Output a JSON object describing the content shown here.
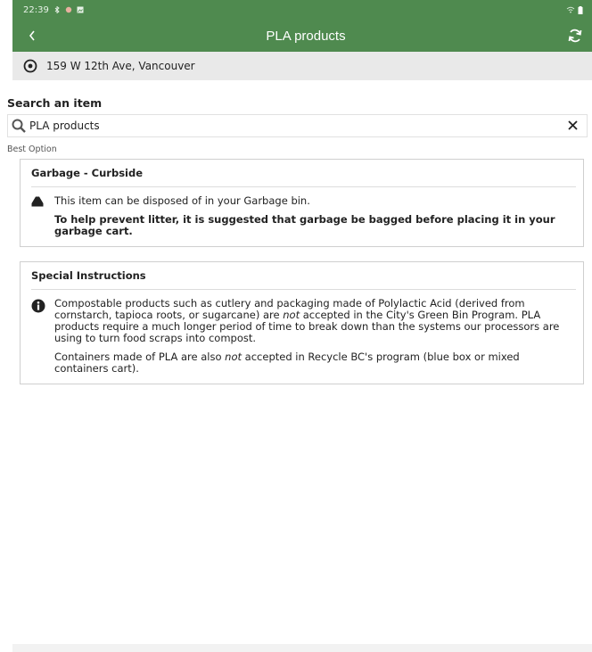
{
  "status": {
    "time": "22:39"
  },
  "appbar": {
    "title": "PLA products",
    "back_icon": "chevron-left-icon",
    "refresh_icon": "refresh-icon",
    "color": "#4f8a4f"
  },
  "address": {
    "text": "159 W 12th Ave, Vancouver",
    "icon": "location-pin-icon"
  },
  "search": {
    "label": "Search an item",
    "value": "PLA products",
    "icon": "search-icon",
    "clear_icon": "close-icon"
  },
  "best_option": {
    "label": "Best Option"
  },
  "garbage_card": {
    "title": "Garbage  -  Curbside",
    "line1": "This item can be disposed of in your Garbage bin.",
    "line2": "To help prevent litter, it is suggested that garbage be bagged before placing it in your garbage cart.",
    "icon": "garbage-bin-icon"
  },
  "special": {
    "title": "Special Instructions",
    "icon": "info-icon",
    "p1_a": "Compostable products such as cutlery and packaging made of Polylactic Acid (derived from cornstarch, tapioca roots, or sugarcane) are ",
    "p1_em": "not",
    "p1_b": " accepted in the City's Green Bin Program. PLA products require a much longer period of time to break down than the systems our processors are using to turn food scraps into compost.",
    "p2_a": "Containers made of PLA are also ",
    "p2_em": "not",
    "p2_b": " accepted in Recycle BC's program (blue box or mixed containers cart)."
  }
}
